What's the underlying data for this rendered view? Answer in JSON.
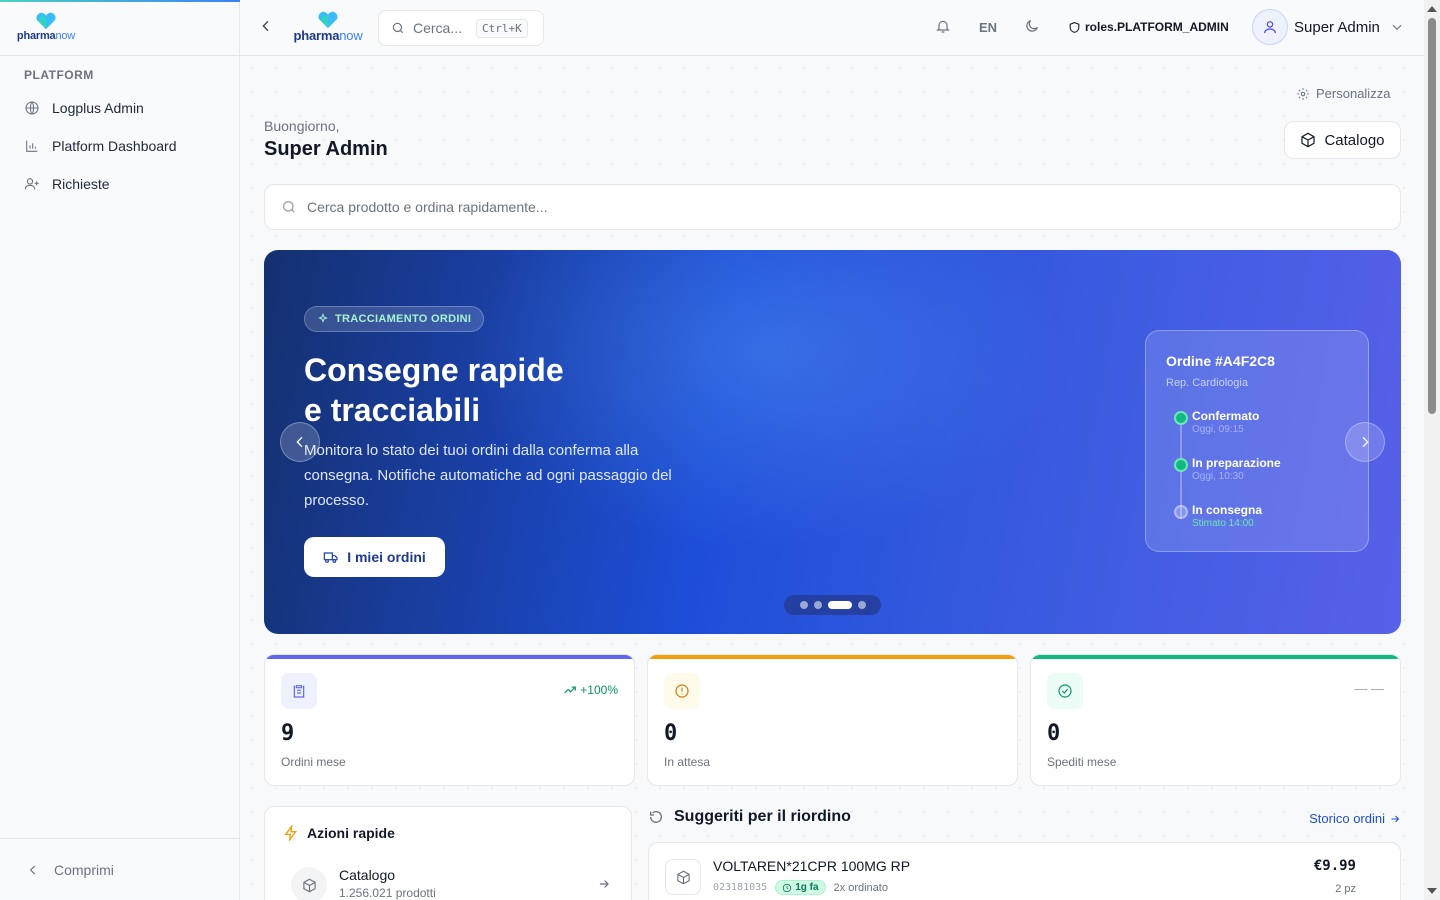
{
  "brand": {
    "name_bold": "pharma",
    "name_light": "now"
  },
  "sidebar": {
    "section_title": "PLATFORM",
    "items": [
      {
        "label": "Logplus Admin",
        "icon": "globe-icon"
      },
      {
        "label": "Platform Dashboard",
        "icon": "bar-chart-icon"
      },
      {
        "label": "Richieste",
        "icon": "user-plus-icon"
      }
    ],
    "collapse_label": "Comprimi"
  },
  "topbar": {
    "search_placeholder": "Cerca...",
    "search_shortcut": "Ctrl+K",
    "language": "EN",
    "role": "roles.PLATFORM_ADMIN",
    "user_name": "Super Admin"
  },
  "main": {
    "personalize_label": "Personalizza",
    "greeting": "Buongiorno,",
    "user_name": "Super Admin",
    "catalog_button": "Catalogo",
    "quick_search_placeholder": "Cerca prodotto e ordina rapidamente..."
  },
  "hero": {
    "tag": "TRACCIAMENTO ORDINI",
    "title_line1": "Consegne rapide",
    "title_line2": "e tracciabili",
    "description": "Monitora lo stato dei tuoi ordini dalla conferma alla consegna. Notifiche automatiche ad ogni passaggio del processo.",
    "button": "I miei ordini",
    "slides_total": 4,
    "active_slide": 3,
    "order_card": {
      "title": "Ordine #A4F2C8",
      "subtitle": "Rep. Cardiologia",
      "steps": [
        {
          "label": "Confermato",
          "time": "Oggi, 09:15",
          "status": "done"
        },
        {
          "label": "In preparazione",
          "time": "Oggi, 10:30",
          "status": "done"
        },
        {
          "label": "In consegna",
          "time": "Stimato 14:00",
          "status": "pending"
        }
      ]
    }
  },
  "stats": [
    {
      "value": "9",
      "label": "Ordini mese",
      "trend": "+100%",
      "color": "#6366f1"
    },
    {
      "value": "0",
      "label": "In attesa",
      "trend": "",
      "color": "#f59e0b"
    },
    {
      "value": "0",
      "label": "Spediti mese",
      "trend": "— —",
      "color": "#10b981"
    }
  ],
  "quick_actions": {
    "title": "Azioni rapide",
    "items": [
      {
        "label": "Catalogo",
        "sub": "1.256.021 prodotti"
      }
    ]
  },
  "suggestions": {
    "title": "Suggeriti per il riordino",
    "link": "Storico ordini",
    "items": [
      {
        "name": "VOLTAREN*21CPR 100MG RP",
        "code": "023181035",
        "badge": "1g fa",
        "ordered": "2x ordinato",
        "price": "€9.99",
        "qty": "2 pz"
      }
    ]
  }
}
